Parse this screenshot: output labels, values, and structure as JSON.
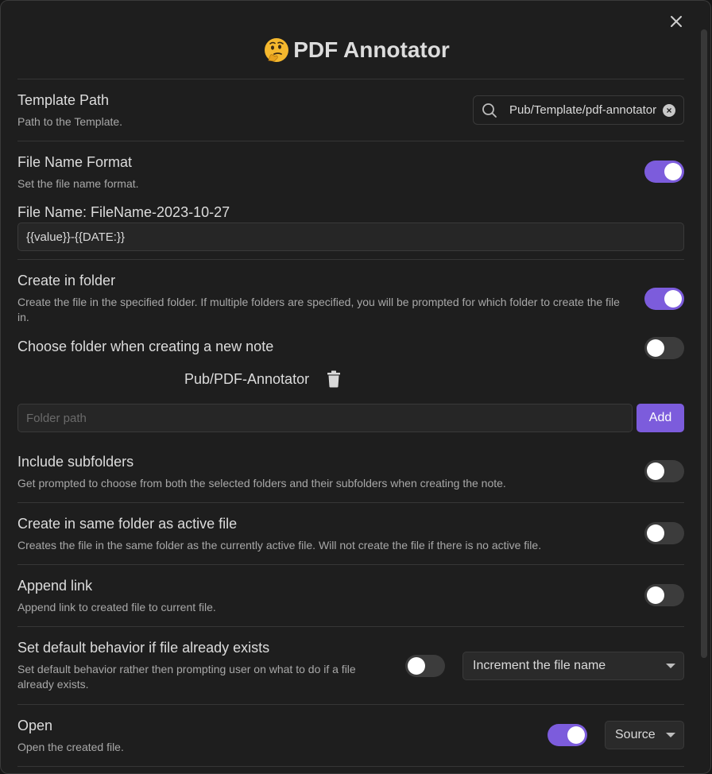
{
  "modal": {
    "title": "PDF Annotator",
    "title_emoji": "thinking-face-icon"
  },
  "template_path": {
    "name": "Template Path",
    "desc": "Path to the Template.",
    "value": "Pub/Template/pdf-annotator"
  },
  "file_name_format": {
    "name": "File Name Format",
    "desc": "Set the file name format.",
    "enabled": true,
    "preview": "File Name: FileName-2023-10-27",
    "value": "{{value}}-{{DATE:}}"
  },
  "create_in_folder": {
    "name": "Create in folder",
    "desc": "Create the file in the specified folder. If multiple folders are specified, you will be prompted for which folder to create the file in.",
    "enabled": true
  },
  "choose_folder": {
    "name": "Choose folder when creating a new note",
    "enabled": false,
    "folders": [
      "Pub/PDF-Annotator"
    ],
    "folder_input_placeholder": "Folder path",
    "add_label": "Add"
  },
  "include_subfolders": {
    "name": "Include subfolders",
    "desc": "Get prompted to choose from both the selected folders and their subfolders when creating the note.",
    "enabled": false
  },
  "same_folder": {
    "name": "Create in same folder as active file",
    "desc": "Creates the file in the same folder as the currently active file. Will not create the file if there is no active file.",
    "enabled": false
  },
  "append_link": {
    "name": "Append link",
    "desc": "Append link to created file to current file.",
    "enabled": false
  },
  "default_behavior": {
    "name": "Set default behavior if file already exists",
    "desc": "Set default behavior rather then prompting user on what to do if a file already exists.",
    "enabled": false,
    "selected": "Increment the file name"
  },
  "open": {
    "name": "Open",
    "desc": "Open the created file.",
    "enabled": true,
    "selected": "Source"
  },
  "colors": {
    "accent": "#7c5cdc",
    "background": "#1e1e1e"
  }
}
